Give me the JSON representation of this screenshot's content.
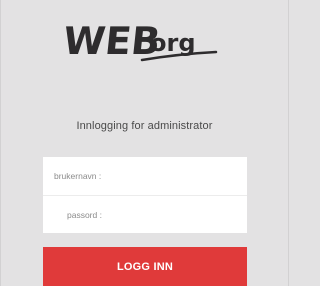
{
  "logo": {
    "text_part1": "WEB",
    "text_part2": "org"
  },
  "heading": "Innlogging for administrator",
  "form": {
    "username_placeholder": "brukernavn :",
    "username_value": "",
    "password_placeholder": "passord :",
    "password_value": "",
    "submit_label": "LOGG INN"
  },
  "colors": {
    "background": "#e3e2e3",
    "accent": "#e03a3a",
    "logo": "#2e2c2e"
  }
}
